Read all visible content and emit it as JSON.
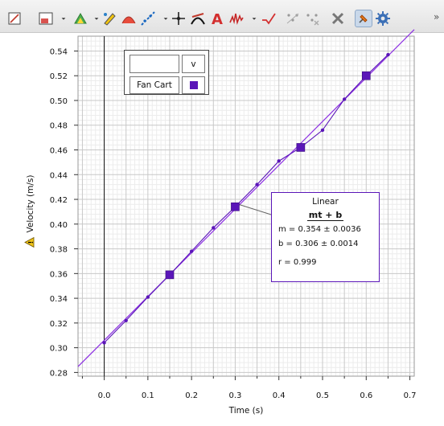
{
  "toolbar": {
    "buttons": [
      {
        "icon": "graph-options-icon",
        "x": 18
      },
      {
        "icon": "view-layout-icon",
        "x": 57
      },
      {
        "icon": "chevron-down-icon",
        "x": 79
      },
      {
        "icon": "triangle-analysis-icon",
        "x": 100
      },
      {
        "icon": "chevron-down-icon",
        "x": 120
      },
      {
        "icon": "pencil-icon",
        "x": 136
      },
      {
        "icon": "peak-icon",
        "x": 160
      },
      {
        "icon": "curve-fit-icon",
        "x": 184
      },
      {
        "icon": "chevron-down-icon",
        "x": 206
      },
      {
        "icon": "crosshair-icon",
        "x": 222
      },
      {
        "icon": "tangent-icon",
        "x": 246
      },
      {
        "icon": "annotation-icon",
        "x": 270
      },
      {
        "icon": "noise-icon",
        "x": 294
      },
      {
        "icon": "chevron-down-icon",
        "x": 316
      },
      {
        "icon": "model-icon",
        "x": 334
      },
      {
        "icon": "scatter-off-icon",
        "x": 364
      },
      {
        "icon": "scatter-remove-icon",
        "x": 388
      },
      {
        "icon": "close-x-icon",
        "x": 420
      },
      {
        "icon": "pin-icon",
        "x": 452
      },
      {
        "icon": "gear-icon",
        "x": 476
      }
    ],
    "more_label": "»"
  },
  "legend": {
    "column_label": "v",
    "series_label": "Fan Cart"
  },
  "fit": {
    "title": "Linear",
    "equation": "mt + b",
    "m_line": "m = 0.354 ± 0.0036",
    "b_line": "b  = 0.306 ± 0.0014",
    "r_line": "r = 0.999"
  },
  "colors": {
    "series": "#5a16b8",
    "fit_line": "#8a2be2",
    "grid_major": "#c8c8c8",
    "grid_minor": "#ececec"
  },
  "chart_data": {
    "type": "scatter",
    "title": "",
    "xlabel": "Time (s)",
    "ylabel": "Velocity (m/s)",
    "xlim": [
      -0.06,
      0.71
    ],
    "ylim": [
      0.277,
      0.552
    ],
    "x_ticks": [
      0.0,
      0.1,
      0.2,
      0.3,
      0.4,
      0.5,
      0.6,
      0.7
    ],
    "x_tick_labels": [
      "0.0",
      "0.1",
      "0.2",
      "0.3",
      "0.4",
      "0.5",
      "0.6",
      "0.7"
    ],
    "y_ticks": [
      0.28,
      0.3,
      0.32,
      0.34,
      0.36,
      0.38,
      0.4,
      0.42,
      0.44,
      0.46,
      0.48,
      0.5,
      0.52,
      0.54
    ],
    "y_tick_labels": [
      "0.28",
      "0.30",
      "0.32",
      "0.34",
      "0.36",
      "0.38",
      "0.40",
      "0.42",
      "0.44",
      "0.46",
      "0.48",
      "0.50",
      "0.52",
      "0.54"
    ],
    "grid": true,
    "legend_position": "top-left",
    "series": [
      {
        "name": "Fan Cart",
        "x": [
          0.0,
          0.05,
          0.1,
          0.15,
          0.2,
          0.25,
          0.3,
          0.35,
          0.4,
          0.45,
          0.5,
          0.55,
          0.6,
          0.65
        ],
        "y": [
          0.304,
          0.322,
          0.341,
          0.359,
          0.378,
          0.397,
          0.414,
          0.432,
          0.451,
          0.462,
          0.476,
          0.501,
          0.52,
          0.537
        ],
        "selected_points": [
          3,
          6,
          9,
          12
        ]
      }
    ],
    "fit": {
      "type": "linear",
      "m": 0.354,
      "b": 0.306,
      "x_range": [
        -0.06,
        0.71
      ]
    }
  }
}
